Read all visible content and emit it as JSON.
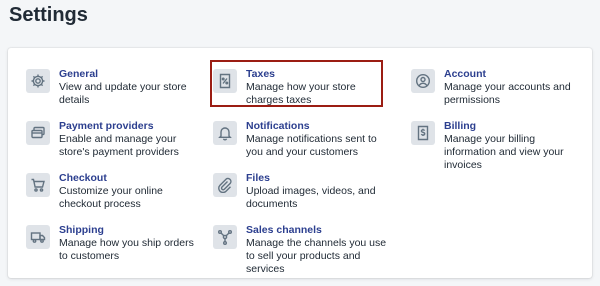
{
  "page": {
    "title": "Settings"
  },
  "settings": {
    "general": {
      "title": "General",
      "description": "View and update your store details",
      "icon": "gear-icon"
    },
    "payment_providers": {
      "title": "Payment providers",
      "description": "Enable and manage your store's payment providers",
      "icon": "credit-card-icon"
    },
    "checkout": {
      "title": "Checkout",
      "description": "Customize your online checkout process",
      "icon": "cart-icon"
    },
    "shipping": {
      "title": "Shipping",
      "description": "Manage how you ship orders to customers",
      "icon": "truck-icon"
    },
    "taxes": {
      "title": "Taxes",
      "description": "Manage how your store charges taxes",
      "icon": "tax-receipt-icon"
    },
    "notifications": {
      "title": "Notifications",
      "description": "Manage notifications sent to you and your customers",
      "icon": "bell-icon"
    },
    "files": {
      "title": "Files",
      "description": "Upload images, videos, and documents",
      "icon": "paperclip-icon"
    },
    "sales_channels": {
      "title": "Sales channels",
      "description": "Manage the channels you use to sell your products and services",
      "icon": "channels-icon"
    },
    "account": {
      "title": "Account",
      "description": "Manage your accounts and permissions",
      "icon": "user-circle-icon"
    },
    "billing": {
      "title": "Billing",
      "description": "Manage your billing information and view your invoices",
      "icon": "dollar-invoice-icon"
    }
  },
  "colors": {
    "link": "#2c3f8f",
    "text": "#212b36",
    "icon_bg": "#dfe3e8",
    "icon_fg": "#637381",
    "highlight": "#9b1d13"
  }
}
